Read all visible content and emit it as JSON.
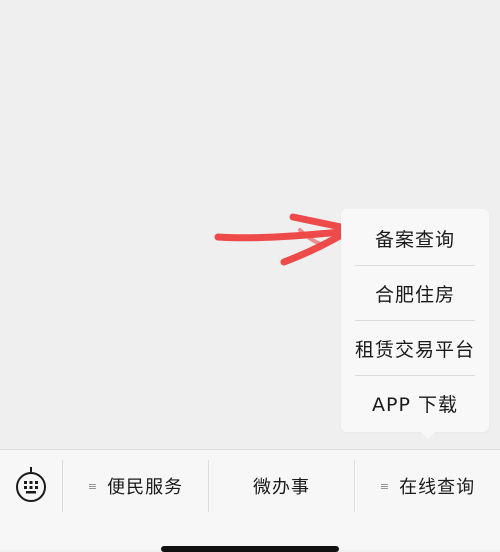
{
  "popup_menu": {
    "items": [
      {
        "label": "备案查询"
      },
      {
        "label": "合肥住房"
      },
      {
        "label": "租赁交易平台"
      },
      {
        "label": "APP 下载"
      }
    ]
  },
  "bottom_bar": {
    "keyboard_icon": "keyboard-icon",
    "tabs": [
      {
        "label": "便民服务",
        "icon": "menu-lines-icon"
      },
      {
        "label": "微办事"
      },
      {
        "label": "在线查询",
        "icon": "menu-lines-icon"
      }
    ]
  },
  "colors": {
    "annotation": "#ee4a4a",
    "background": "#efefef",
    "popup": "#f8f8f8"
  }
}
